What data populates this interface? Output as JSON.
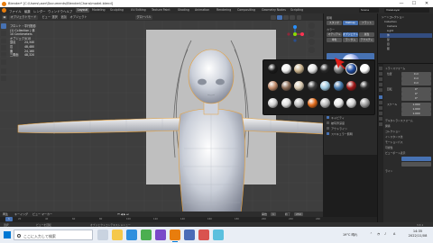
{
  "window": {
    "title": "Blender* [C:\\Users\\user\\Documents\\Blender\\Chara\\model.blend]",
    "min_glyph": "—",
    "max_glyph": "☐",
    "close_glyph": "✕"
  },
  "menu": {
    "items": [
      "ファイル",
      "編集",
      "レンダー",
      "ウィンドウ",
      "ヘルプ"
    ],
    "workspaces": [
      "Layout",
      "Modeling",
      "Sculpting",
      "UV Editing",
      "Texture Paint",
      "Shading",
      "Animation",
      "Rendering",
      "Compositing",
      "Geometry Nodes",
      "Scripting"
    ],
    "scene": "Scene",
    "view_layer": "ViewLayer"
  },
  "viewport": {
    "header": [
      "オブジェクトモード",
      "ビュー",
      "選択",
      "追加",
      "オブジェクト"
    ],
    "header_right": [
      "グローバル"
    ],
    "info": {
      "view": "フロント・平行投影",
      "collection": "(1) Collection | 体",
      "unit": "10 Centimeters",
      "objects_label": "オブジェクト",
      "objects_value": "1/18",
      "rows": [
        {
          "label": "頂点",
          "value": "24,340"
        },
        {
          "label": "辺",
          "value": "48,480"
        },
        {
          "label": "面",
          "value": "24,160"
        },
        {
          "label": "三角面",
          "value": "48,320"
        }
      ]
    }
  },
  "shading_panel": {
    "lighting_label": "照明",
    "lighting_options": [
      "スタジオ",
      "MatCap",
      "フラット"
    ],
    "color_label": "カラー",
    "color_options": [
      "マテリアル",
      "オブジェクト",
      "属性"
    ],
    "color_options2": [
      "単色",
      "ランダム",
      "テクスチャ"
    ],
    "background_label": "背景",
    "background_options": [
      "テーマ",
      "ワールド",
      "ビューポート"
    ],
    "options_label": "オプション",
    "backface_label": "背面カリング",
    "xray_label": "透過表示",
    "shadow_label": "シャドウ",
    "cavity_label": "キャビティ",
    "dof_label": "被写界深度",
    "outline_label": "アウトライン",
    "specular_label": "スペキュラー照明"
  },
  "outliner": {
    "rows": [
      "シーンコレクション",
      "Collection",
      "Camera",
      "Light",
      "体",
      "髪",
      "目",
      "服"
    ]
  },
  "properties": {
    "rows": [
      "トランスフォーム",
      "位置",
      "回転",
      "スケール",
      "デルタトランスフォーム",
      "関係",
      "コレクション",
      "インスタンス化",
      "モーションパス",
      "可視性",
      "ビューポート表示",
      "ライン"
    ],
    "values": [
      "0 m",
      "0°",
      "1.000"
    ],
    "section": "ビューポート表示"
  },
  "timeline": {
    "header": [
      "再生",
      "キーイング",
      "ビュー",
      "マーカー"
    ],
    "ticks": [
      "0",
      "20",
      "40",
      "60",
      "80",
      "100",
      "120",
      "140",
      "160",
      "180",
      "200",
      "220",
      "240"
    ],
    "current_frame": "1",
    "start_label": "開始",
    "start": "1",
    "end_label": "終了",
    "end": "250"
  },
  "status": {
    "left": "選択",
    "mid": "ビューを回転",
    "right": "オブジェクトコンテキストメニュー",
    "version": "3.3.1"
  },
  "taskbar": {
    "search_placeholder": "ここに入力して検索",
    "tray": "19°C 晴れ",
    "ime": "A",
    "time": "14:35",
    "date": "2022/11/08"
  },
  "colors": {
    "accent": "#4772b3",
    "selection_outline": "#e8a13a",
    "blender_orange": "#e87d0d",
    "arrow": "#e0201a"
  },
  "matcaps": [
    "#1a1a1a",
    "#f0f0f0",
    "#c7b08a",
    "#e3e3e3",
    "#2a2a2a",
    "#7a7a7a",
    "#1e4a9e",
    "#ffffff",
    "#c08a6a",
    "#8a6a55",
    "#d9c9b0",
    "#3b3b3b",
    "#9ec9e0",
    "#4477aa",
    "#a01818",
    "#2b2b2b",
    "#cfcfcf",
    "#dedede",
    "#bfbfbf",
    "#e06a1a",
    "#b8b8b8",
    "#e8e8e8",
    "#d0d0d0",
    "#9a9a9a"
  ]
}
